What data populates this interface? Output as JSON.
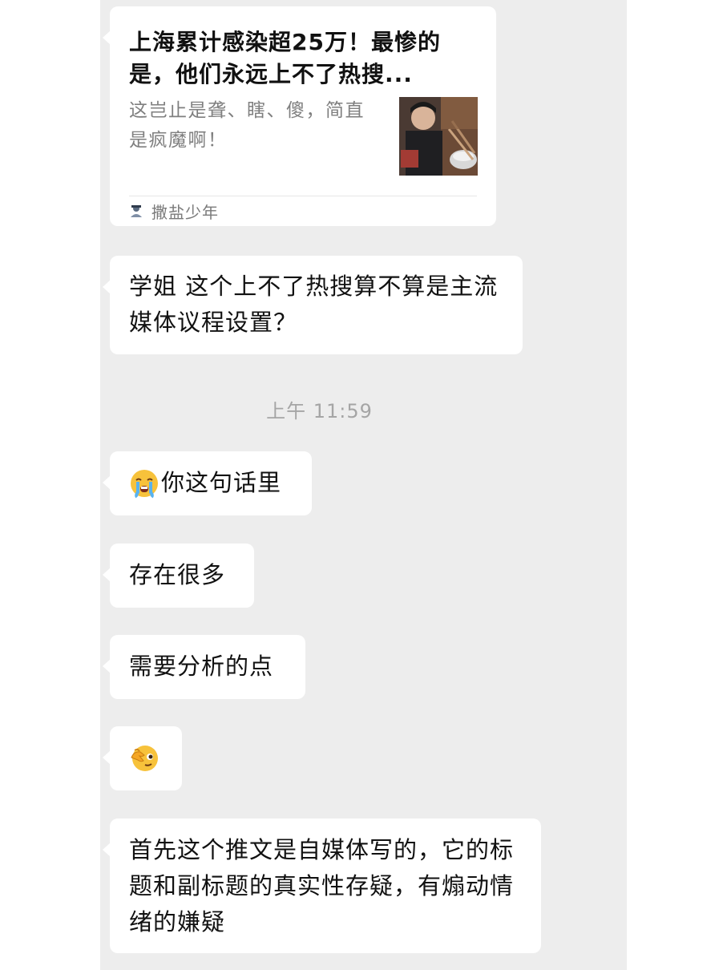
{
  "article_card": {
    "title": "上海累计感染超25万！最惨的是，他们永远上不了热搜...",
    "description": "这岂止是聋、瞎、傻，简直是疯魔啊！",
    "source_name": "撒盐少年",
    "thumbnail_icon": "photo-thumbnail"
  },
  "messages": [
    {
      "text": "学姐 这个上不了热搜算不算是主流媒体议程设置？"
    },
    {
      "emoji": "crying-face-emoji",
      "text": "你这句话里"
    },
    {
      "text": "存在很多"
    },
    {
      "text": "需要分析的点"
    },
    {
      "emoji": "facepalm-emoji",
      "text": ""
    },
    {
      "text": "首先这个推文是自媒体写的，它的标题和副标题的真实性存疑，有煽动情绪的嫌疑"
    }
  ],
  "timestamp": "上午 11:59",
  "colors": {
    "chat_background": "#ededed",
    "bubble": "#ffffff",
    "text": "#111111",
    "secondary_text": "#7f7f7f",
    "timestamp": "#a5a5a5"
  }
}
